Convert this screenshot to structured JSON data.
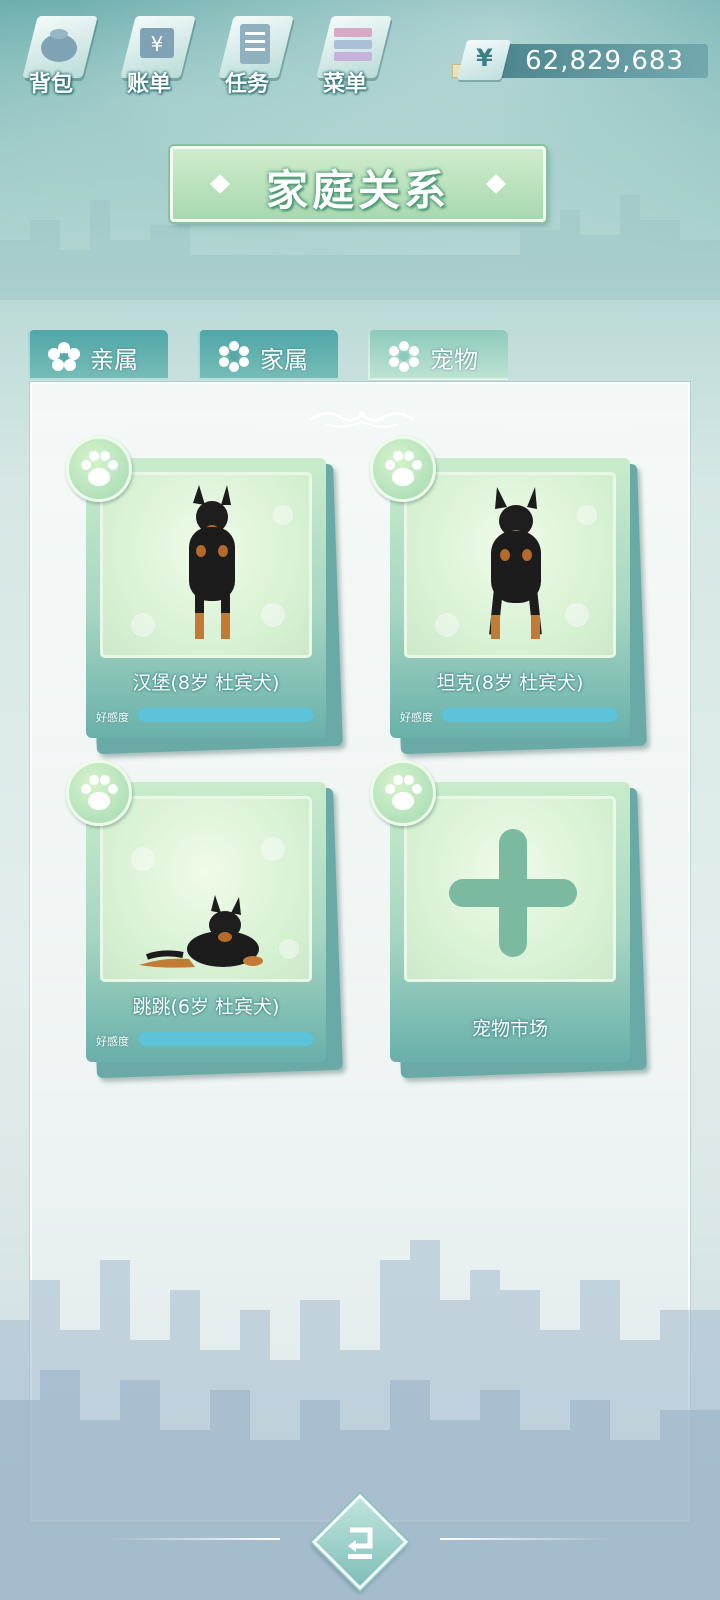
{
  "topbar": {
    "menu": [
      {
        "label": "背包",
        "icon": "bag-icon"
      },
      {
        "label": "账单",
        "icon": "bill-icon"
      },
      {
        "label": "任务",
        "icon": "task-icon"
      },
      {
        "label": "菜单",
        "icon": "menu-icon"
      }
    ],
    "currency_symbol": "¥",
    "money": "62,829,683"
  },
  "title": "家庭关系",
  "tabs": [
    {
      "label": "亲属",
      "icon": "flower-icon",
      "active": false
    },
    {
      "label": "家属",
      "icon": "flower-icon",
      "active": false
    },
    {
      "label": "宠物",
      "icon": "flower-icon",
      "active": true
    }
  ],
  "pets": [
    {
      "name": "汉堡(8岁 杜宾犬)",
      "favor_label": "好感度",
      "favor": 1.0,
      "pose": "standing"
    },
    {
      "name": "坦克(8岁 杜宾犬)",
      "favor_label": "好感度",
      "favor": 1.0,
      "pose": "standing"
    },
    {
      "name": "跳跳(6岁 杜宾犬)",
      "favor_label": "好感度",
      "favor": 1.0,
      "pose": "lying"
    }
  ],
  "market": {
    "label": "宠物市场"
  },
  "colors": {
    "accent": "#5cc3da",
    "card_dark": "#69b0aa",
    "card_light": "#c9eccb"
  }
}
